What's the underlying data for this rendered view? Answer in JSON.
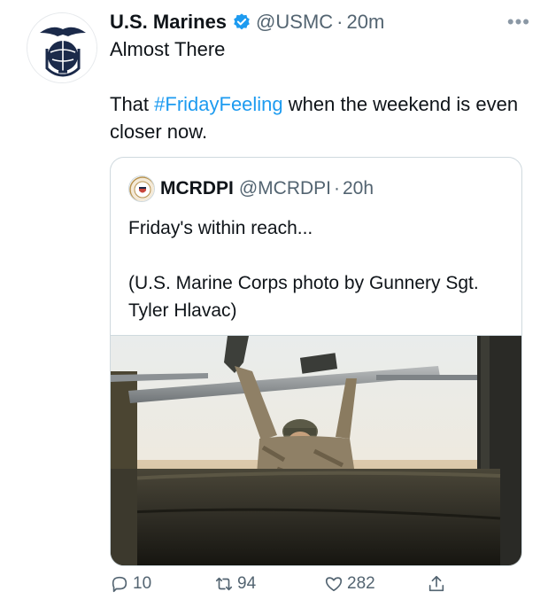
{
  "tweet": {
    "author_name": "U.S. Marines",
    "author_handle": "@USMC",
    "separator": "·",
    "time": "20m",
    "more_label": "•••",
    "title": "Almost There",
    "body_prefix": "That ",
    "hashtag": "#FridayFeeling",
    "body_suffix": " when the weekend is even closer now.",
    "verified_color": "#1d9bf0",
    "link_color": "#1d9bf0"
  },
  "quoted_tweet": {
    "author_name": "MCRDPI",
    "author_handle": "@MCRDPI",
    "separator": "·",
    "time": "20h",
    "text": "Friday's within reach...\n\n(U.S. Marine Corps photo by Gunnery Sgt. Tyler Hlavac)"
  },
  "actions": {
    "reply_count": "10",
    "retweet_count": "94",
    "like_count": "282",
    "icons": [
      "reply-icon",
      "retweet-icon",
      "like-icon",
      "share-icon"
    ]
  }
}
